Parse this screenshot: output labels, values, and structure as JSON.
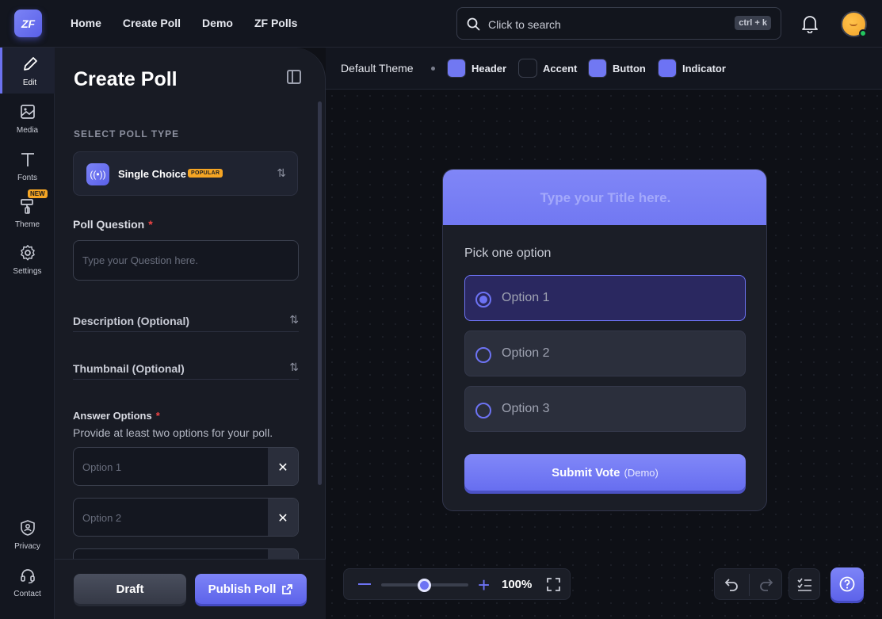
{
  "brand": {
    "logo_text": "ZF"
  },
  "nav": [
    "Home",
    "Create Poll",
    "Demo",
    "ZF Polls"
  ],
  "search": {
    "placeholder": "Click to search",
    "shortcut": "ctrl + k"
  },
  "rail": {
    "items": [
      {
        "label": "Edit",
        "icon": "pencil-icon",
        "active": true
      },
      {
        "label": "Media",
        "icon": "image-icon"
      },
      {
        "label": "Fonts",
        "icon": "text-icon"
      },
      {
        "label": "Theme",
        "icon": "paint-roller-icon",
        "badge": "NEW"
      },
      {
        "label": "Settings",
        "icon": "gear-icon"
      }
    ],
    "bottom_items": [
      {
        "label": "Privacy",
        "icon": "shield-user-icon"
      },
      {
        "label": "Contact",
        "icon": "headset-icon"
      }
    ]
  },
  "panel": {
    "title": "Create Poll",
    "select_type_label": "SELECT POLL TYPE",
    "poll_type": {
      "name": "Single Choice",
      "badge": "POPULAR"
    },
    "question": {
      "label": "Poll Question",
      "required": "*",
      "placeholder": "Type your Question here."
    },
    "description_label": "Description (Optional)",
    "thumbnail_label": "Thumbnail (Optional)",
    "answers": {
      "label": "Answer Options",
      "required": "*",
      "hint": "Provide at least two options for your poll.",
      "options": [
        {
          "placeholder": "Option 1"
        },
        {
          "placeholder": "Option 2"
        }
      ]
    },
    "draft_label": "Draft",
    "publish_label": "Publish Poll"
  },
  "theme": {
    "name": "Default Theme",
    "swatches": [
      {
        "label": "Header",
        "color": "#7178f2"
      },
      {
        "label": "Accent",
        "color": "#13161f"
      },
      {
        "label": "Button",
        "color": "#7178f2"
      },
      {
        "label": "Indicator",
        "color": "#6d73f4"
      }
    ]
  },
  "preview": {
    "title_placeholder": "Type your Title here.",
    "subtitle": "Pick one option",
    "options": [
      "Option 1",
      "Option 2",
      "Option 3"
    ],
    "selected_index": 0,
    "submit_label": "Submit Vote",
    "submit_suffix": "(Demo)"
  },
  "zoom": {
    "value": "100%",
    "level_fraction": 0.5
  },
  "colors": {
    "accent": "#6d73f4",
    "background": "#0f1117",
    "required": "#ef4444",
    "badge": "#f5a524"
  }
}
